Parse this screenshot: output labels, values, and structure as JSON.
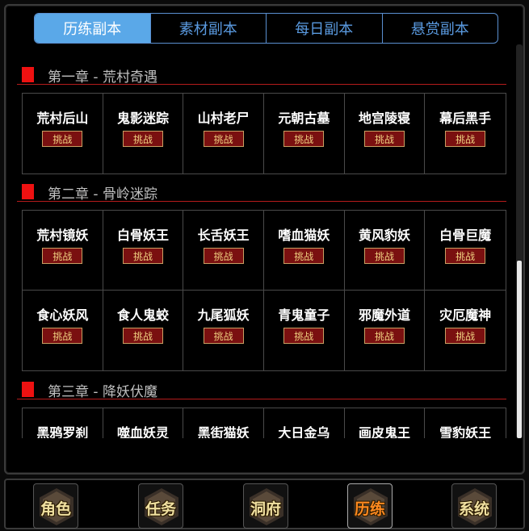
{
  "tabs": [
    {
      "label": "历练副本",
      "active": true
    },
    {
      "label": "素材副本",
      "active": false
    },
    {
      "label": "每日副本",
      "active": false
    },
    {
      "label": "悬赏副本",
      "active": false
    }
  ],
  "challenge_label": "挑战",
  "chapters": [
    {
      "title": "第一章 - 荒村奇遇",
      "stages": [
        "荒村后山",
        "鬼影迷踪",
        "山村老尸",
        "元朝古墓",
        "地宫陵寝",
        "幕后黑手"
      ]
    },
    {
      "title": "第二章 - 骨岭迷踪",
      "stages": [
        "荒村镜妖",
        "白骨妖王",
        "长舌妖王",
        "嗜血猫妖",
        "黄风豹妖",
        "白骨巨魔",
        "食心妖风",
        "食人鬼蛟",
        "九尾狐妖",
        "青鬼童子",
        "邪魔外道",
        "灾厄魔神"
      ]
    },
    {
      "title": "第三章 - 降妖伏魔",
      "stages": [
        "黑鸦罗刹",
        "噬血妖灵",
        "黑街猫妖",
        "大日金乌",
        "画皮鬼王",
        "雪豹妖王"
      ]
    }
  ],
  "bottom_nav": [
    {
      "label": "角色",
      "active": false
    },
    {
      "label": "任务",
      "active": false
    },
    {
      "label": "洞府",
      "active": false
    },
    {
      "label": "历练",
      "active": true
    },
    {
      "label": "系统",
      "active": false
    }
  ],
  "colors": {
    "tab_active_bg": "#5aa8e8",
    "tab_text": "#5a9ae0",
    "chapter_marker": "#ee1111",
    "challenge_bg": "#7a1010",
    "nav_active_text": "#ff8a20"
  }
}
